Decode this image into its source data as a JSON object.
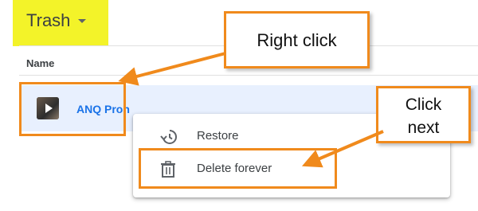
{
  "header": {
    "title": "Trash"
  },
  "list": {
    "column_name": "Name",
    "files": [
      {
        "name": "ANQ Pron"
      }
    ]
  },
  "context_menu": {
    "items": [
      {
        "label": "Restore",
        "icon": "restore-history-icon"
      },
      {
        "label": "Delete forever",
        "icon": "trash-can-icon"
      }
    ]
  },
  "annotations": {
    "right_click": "Right click",
    "click_next_line1": "Click",
    "click_next_line2": "next"
  },
  "colors": {
    "annotation_orange": "#f08a1c",
    "highlight_yellow": "#f3f329",
    "selected_row": "#e8f0fe",
    "link_blue": "#1a73e8"
  }
}
